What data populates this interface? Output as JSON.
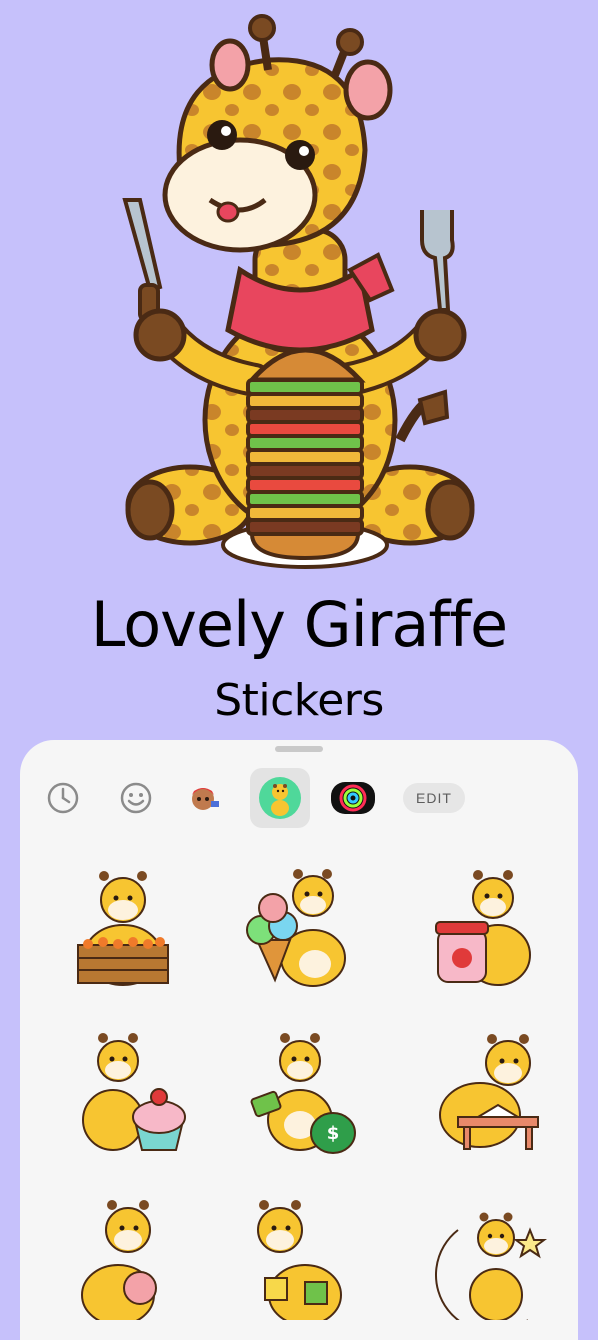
{
  "hero": {
    "title": "Lovely Giraffe",
    "subtitle": "Stickers"
  },
  "tabs": [
    {
      "name": "recent-tab",
      "icon": "clock-icon"
    },
    {
      "name": "emoji-tab",
      "icon": "smiley-icon"
    },
    {
      "name": "memoji-tab",
      "icon": "memoji-icon"
    },
    {
      "name": "giraffe-pack-tab",
      "icon": "giraffe-icon",
      "active": true
    },
    {
      "name": "activity-rings-tab",
      "icon": "activity-rings-icon"
    }
  ],
  "edit_label": "EDIT",
  "stickers": [
    {
      "name": "giraffe-carrot-crate"
    },
    {
      "name": "giraffe-ice-cream"
    },
    {
      "name": "giraffe-strawberry-jam"
    },
    {
      "name": "giraffe-cupcake"
    },
    {
      "name": "giraffe-money"
    },
    {
      "name": "giraffe-reading"
    },
    {
      "name": "giraffe-peach"
    },
    {
      "name": "giraffe-puzzle"
    },
    {
      "name": "giraffe-moon"
    }
  ],
  "colors": {
    "background": "#c6c1fb",
    "sheet": "#f6f6f6",
    "giraffe_yellow": "#f7c531",
    "giraffe_spot": "#c9852b",
    "outline": "#4a2a14"
  }
}
